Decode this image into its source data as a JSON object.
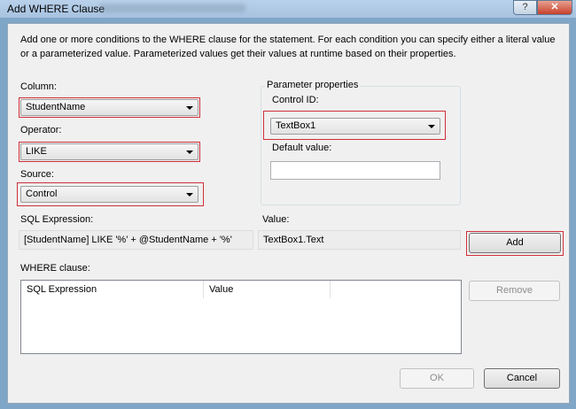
{
  "window": {
    "title": "Add WHERE Clause",
    "help_glyph": "?",
    "close_glyph": "✕"
  },
  "description": "Add one or more conditions to the WHERE clause for the statement. For each condition you can specify either a literal value or a parameterized value. Parameterized values get their values at runtime based on their properties.",
  "column": {
    "label": "Column:",
    "value": "StudentName"
  },
  "operator": {
    "label": "Operator:",
    "value": "LIKE"
  },
  "source": {
    "label": "Source:",
    "value": "Control"
  },
  "parameter_properties": {
    "title": "Parameter properties",
    "control_id_label": "Control ID:",
    "control_id_value": "TextBox1",
    "default_value_label": "Default value:",
    "default_value": ""
  },
  "sql_expression": {
    "label": "SQL Expression:",
    "value": "[StudentName] LIKE '%' + @StudentName + '%'"
  },
  "value": {
    "label": "Value:",
    "value": "TextBox1.Text"
  },
  "buttons": {
    "add": "Add",
    "remove": "Remove",
    "ok": "OK",
    "cancel": "Cancel"
  },
  "where_clause": {
    "label": "WHERE clause:",
    "columns": [
      "SQL Expression",
      "Value"
    ],
    "rows": []
  },
  "colors": {
    "highlight_border": "#d0303a",
    "dialog_background": "#f0f0f0"
  }
}
